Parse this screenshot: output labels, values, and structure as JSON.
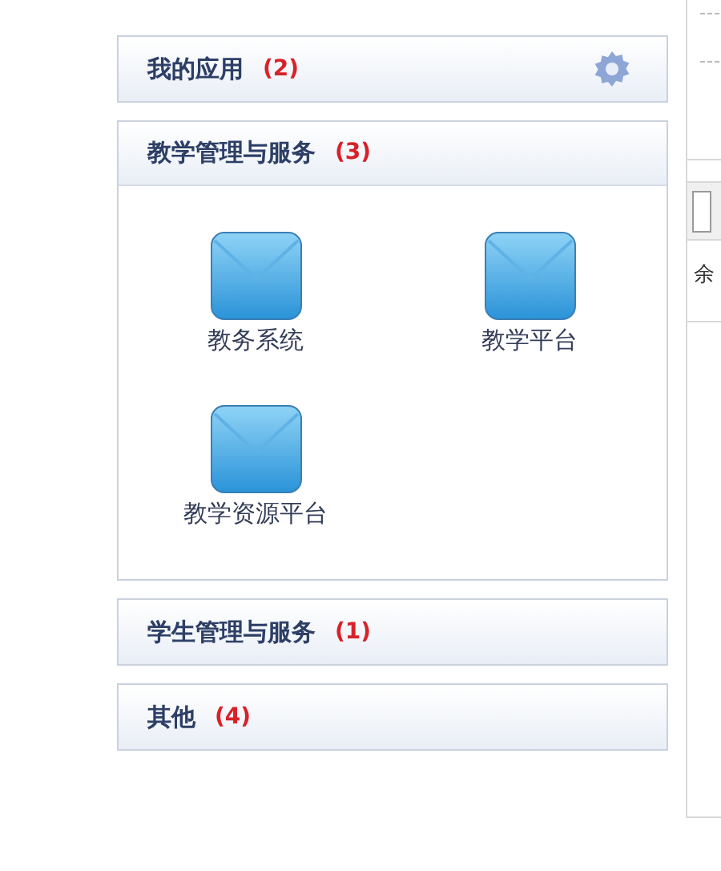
{
  "sections": [
    {
      "title": "我的应用",
      "count": "(2)",
      "expanded": false,
      "settings_button": true
    },
    {
      "title": "教学管理与服务",
      "count": "(3)",
      "expanded": true,
      "settings_button": false,
      "apps": [
        {
          "label": "教务系统"
        },
        {
          "label": "教学平台"
        },
        {
          "label": "教学资源平台"
        }
      ]
    },
    {
      "title": "学生管理与服务",
      "count": "(1)",
      "expanded": false,
      "settings_button": false
    },
    {
      "title": "其他",
      "count": "(4)",
      "expanded": false,
      "settings_button": false
    }
  ],
  "side_panel": {
    "row_text": "余"
  }
}
